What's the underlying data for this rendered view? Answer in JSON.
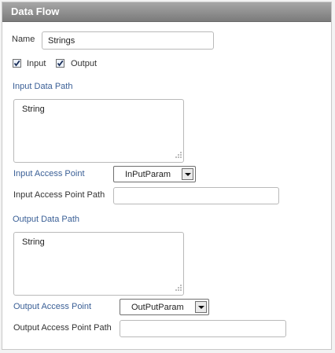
{
  "panel": {
    "title": "Data Flow"
  },
  "name": {
    "label": "Name",
    "value": "Strings"
  },
  "direction": {
    "input": {
      "label": "Input",
      "checked": true
    },
    "output": {
      "label": "Output",
      "checked": true
    }
  },
  "input_section": {
    "data_path_label": "Input Data Path",
    "data_path_value": "String",
    "access_point_label": "Input Access Point",
    "access_point_value": "InPutParam",
    "access_point_path_label": "Input Access Point Path",
    "access_point_path_value": ""
  },
  "output_section": {
    "data_path_label": "Output Data Path",
    "data_path_value": "String",
    "access_point_label": "Output Access Point",
    "access_point_value": "OutPutParam",
    "access_point_path_label": "Output Access Point Path",
    "access_point_path_value": ""
  },
  "colors": {
    "label_blue": "#3a5f96",
    "title_bar": "#8c8c8c"
  }
}
